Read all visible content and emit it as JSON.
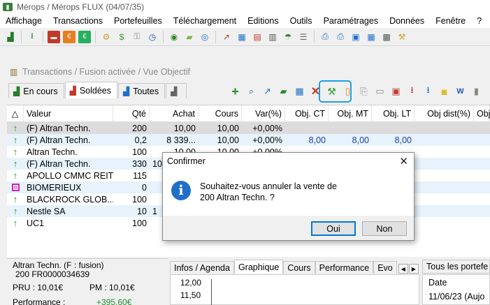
{
  "window": {
    "title": "Mérops / Mérops FLUX (04/07/35)"
  },
  "menu": [
    "Affichage",
    "Transactions",
    "Portefeuilles",
    "Téléchargement",
    "Editions",
    "Outils",
    "Paramétrages",
    "Données",
    "Fenêtre",
    "?"
  ],
  "inner_window": {
    "title": "Transactions / Fusion activée / Vue Objectif"
  },
  "tabs": [
    {
      "label": "En cours",
      "icon": "stock-icon"
    },
    {
      "label": "Soldées",
      "icon": "sold-icon",
      "active": true
    },
    {
      "label": "Toutes",
      "icon": "all-icon"
    },
    {
      "label": "",
      "icon": "bank-icon"
    }
  ],
  "grid": {
    "headers": [
      "",
      "Valeur",
      "Qté",
      "Achat",
      "Cours",
      "Var(%)",
      "Obj. CT",
      "Obj. MT",
      "Obj. LT",
      "Obj dist(%)",
      "Obj"
    ],
    "rows": [
      {
        "icon": "up",
        "valeur": "(F) Altran Techn.",
        "qte": "200",
        "achat": "10,00",
        "cours": "10,00",
        "var": "+0,00%",
        "ct": "",
        "mt": "",
        "lt": "",
        "state": "selected"
      },
      {
        "icon": "up",
        "valeur": "(F) Altran Techn.",
        "qte": "0,2",
        "achat": "8 339...",
        "cours": "10,00",
        "var": "+0,00%",
        "ct": "8,00",
        "mt": "8,00",
        "lt": "8,00",
        "state": "alt"
      },
      {
        "icon": "up",
        "valeur": "Altran Techn.",
        "qte": "100",
        "achat": "10,00",
        "cours": "10,00",
        "var": "+0,00%",
        "ct": "",
        "mt": "",
        "lt": "",
        "state": ""
      },
      {
        "icon": "up",
        "valeur": "(F) Altran Techn.",
        "qte": "330",
        "achat": "10",
        "cours": "",
        "var": "",
        "ct": "",
        "mt": "",
        "lt": "",
        "state": "alt"
      },
      {
        "icon": "up",
        "valeur": "APOLLO CMMC REIT",
        "qte": "115",
        "achat": "",
        "cours": "",
        "var": "",
        "ct": "",
        "mt": "",
        "lt": "",
        "state": ""
      },
      {
        "icon": "box",
        "valeur": "BIOMERIEUX",
        "qte": "0",
        "achat": "",
        "cours": "",
        "var": "",
        "ct": "",
        "mt": "",
        "lt": "",
        "state": "alt"
      },
      {
        "icon": "up",
        "valeur": "BLACKROCK GLOB...",
        "qte": "100",
        "achat": "",
        "cours": "",
        "var": "",
        "ct": "",
        "mt": "",
        "lt": "",
        "state": ""
      },
      {
        "icon": "up",
        "valeur": "Nestle SA",
        "qte": "10",
        "achat": "1",
        "cours": "",
        "var": "",
        "ct": "",
        "mt": "",
        "lt": "",
        "state": "alt"
      },
      {
        "icon": "up",
        "valeur": "UC1",
        "qte": "100",
        "achat": "",
        "cours": "",
        "var": "",
        "ct": "",
        "mt": "",
        "lt": "",
        "state": ""
      }
    ]
  },
  "details": {
    "name": "Altran Techn. (F : fusion)",
    "qty_isin": "200 FR0000034639",
    "pru_label": "PRU : 10,01€",
    "pm_label": "PM : 10,01€",
    "perf_label": "Performance :",
    "perf_value": "+395,60€"
  },
  "bottom_tabs": [
    "Infos / Agenda",
    "Graphique",
    "Cours",
    "Performance",
    "Evo"
  ],
  "chart": {
    "ticks": [
      "12,00",
      "11,50"
    ]
  },
  "right_panel": {
    "tab": "Tous les portefe",
    "header": "Date",
    "row": "11/06/23 (Aujo"
  },
  "dialog": {
    "title": "Confirmer",
    "message_line1": "Souhaitez-vous annuler la vente de",
    "message_line2": "200 Altran Techn. ?",
    "yes": "Oui",
    "no": "Non"
  },
  "colors": {
    "accent": "#1ea0e0",
    "up": "#1d8f2f",
    "value_blue": "#1a3fa8",
    "info_icon": "#1e6fc8",
    "perf_green": "#1d8f2f"
  }
}
